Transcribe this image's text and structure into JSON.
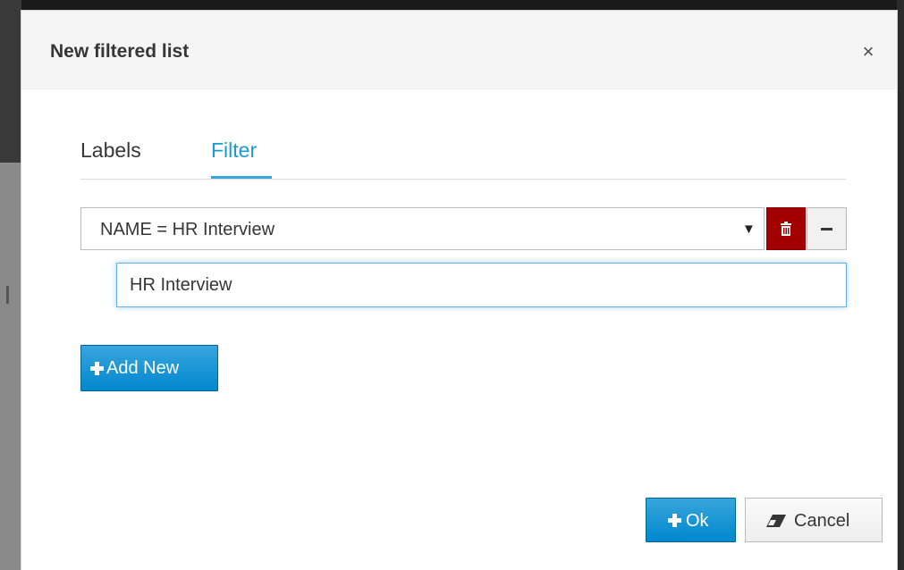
{
  "dialog": {
    "title": "New filtered list",
    "close_symbol": "×"
  },
  "tabs": [
    {
      "label": "Labels",
      "active": false
    },
    {
      "label": "Filter",
      "active": true
    }
  ],
  "filter": {
    "selected_condition": "NAME = HR Interview",
    "caret_symbol": "▼",
    "delete_icon": "trash-icon",
    "collapse_icon": "minus-icon",
    "value": "HR Interview"
  },
  "buttons": {
    "add_new_label": "Add New",
    "ok_label": "Ok",
    "cancel_label": "Cancel"
  },
  "colors": {
    "primary": "#0088ce",
    "danger": "#a30000",
    "active_tab": "#1a9bd1"
  }
}
